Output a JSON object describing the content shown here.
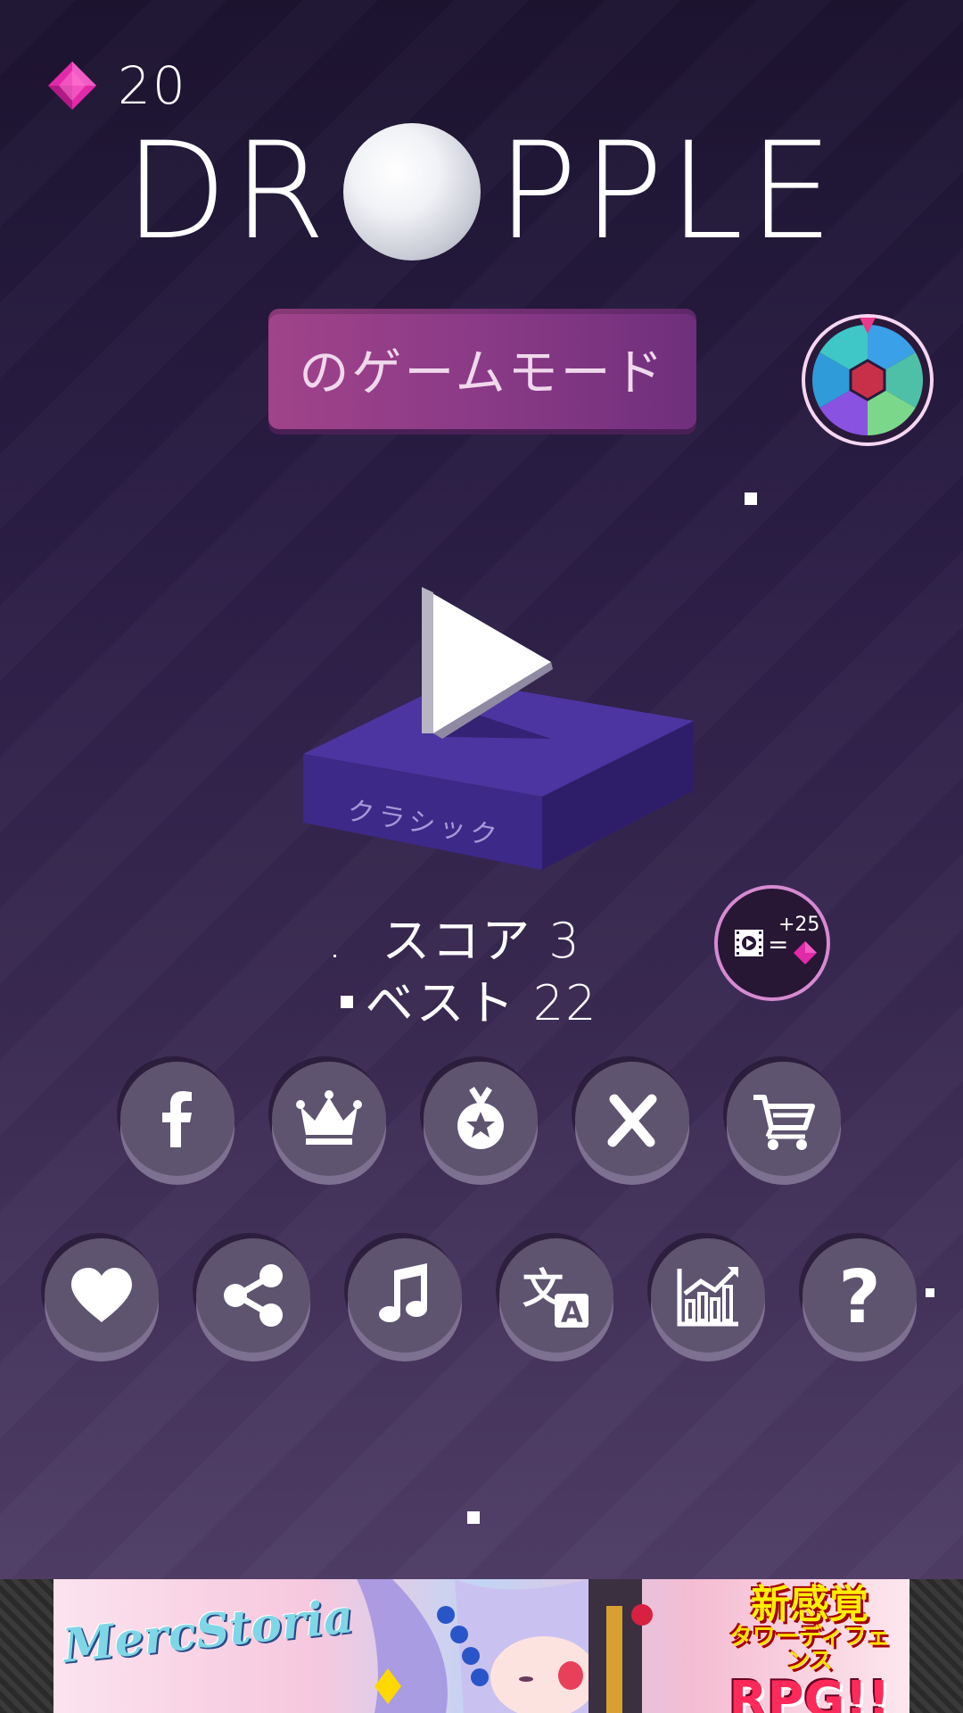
{
  "gems": {
    "count": "20",
    "icon": "gem-icon",
    "color": "#e22aa8"
  },
  "logo": {
    "left": "DR",
    "right": "PPLE"
  },
  "mode_button": {
    "label": "のゲームモード"
  },
  "play": {
    "platform_label": "クラシック"
  },
  "score": {
    "score_text": "スコア 3",
    "best_text": "ベスト 22"
  },
  "video_reward": {
    "amount": "+25"
  },
  "menu_row1": [
    {
      "name": "facebook",
      "icon": "facebook-icon"
    },
    {
      "name": "leaderboard",
      "icon": "crown-icon"
    },
    {
      "name": "achievements",
      "icon": "medal-icon"
    },
    {
      "name": "remove-ads",
      "icon": "x-icon"
    },
    {
      "name": "shop",
      "icon": "cart-icon"
    }
  ],
  "menu_row2": [
    {
      "name": "rate",
      "icon": "heart-icon"
    },
    {
      "name": "share",
      "icon": "share-icon"
    },
    {
      "name": "music",
      "icon": "music-icon"
    },
    {
      "name": "language",
      "icon": "translate-icon"
    },
    {
      "name": "stats",
      "icon": "chart-icon"
    },
    {
      "name": "help",
      "icon": "question-icon"
    }
  ],
  "ad": {
    "logo_text": "MercStoria",
    "tagline1": "新感覚",
    "tagline2": "タワーディフェンス",
    "tagline3": "RPG!!"
  },
  "colors": {
    "accent": "#9b3f88",
    "wheel_ring": "#f5d6f2",
    "button": "#5e5470"
  }
}
